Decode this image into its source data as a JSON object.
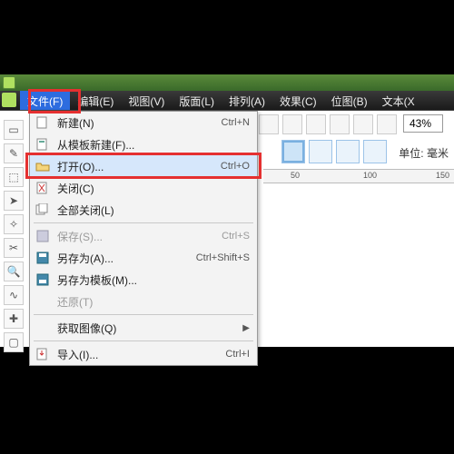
{
  "menubar": {
    "items": [
      "文件(F)",
      "编辑(E)",
      "视图(V)",
      "版面(L)",
      "排列(A)",
      "效果(C)",
      "位图(B)",
      "文本(X"
    ]
  },
  "dropdown": {
    "new": "新建(N)",
    "new_short": "Ctrl+N",
    "new_tpl": "从模板新建(F)...",
    "open": "打开(O)...",
    "open_short": "Ctrl+O",
    "close": "关闭(C)",
    "close_all": "全部关闭(L)",
    "save": "保存(S)...",
    "save_short": "Ctrl+S",
    "saveas": "另存为(A)...",
    "saveas_short": "Ctrl+Shift+S",
    "savetpl": "另存为模板(M)...",
    "revert": "还原(T)",
    "acquire": "获取图像(Q)",
    "import": "导入(I)...",
    "import_short": "Ctrl+I"
  },
  "zoom": "43%",
  "unit_label": "单位:",
  "unit_value": "毫米",
  "ruler": {
    "t0": "50",
    "t1": "100",
    "t2": "150"
  }
}
